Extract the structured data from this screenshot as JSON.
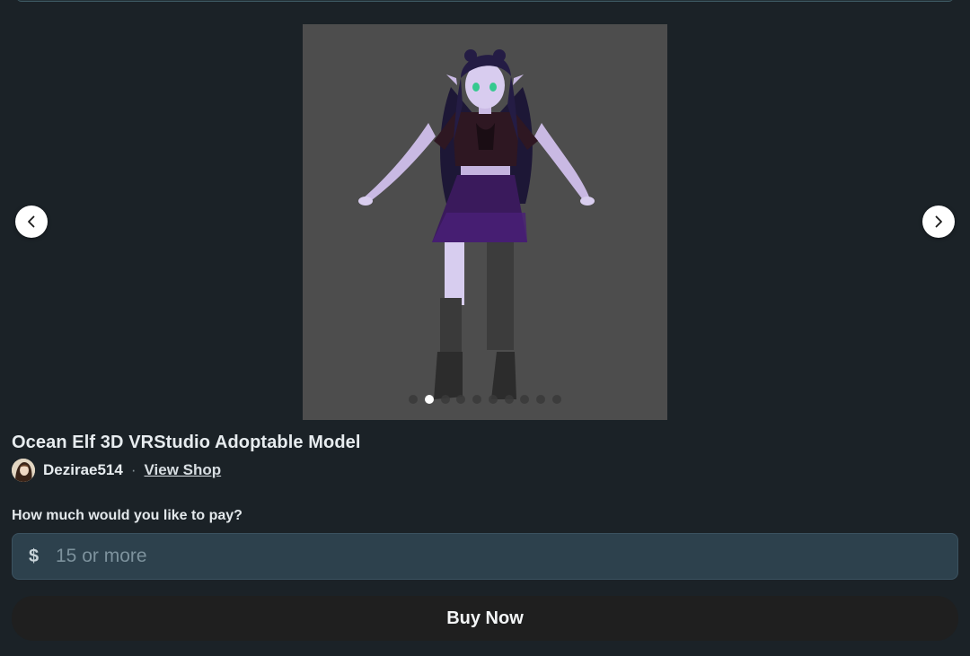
{
  "product": {
    "title": "Ocean Elf 3D VRStudio Adoptable Model"
  },
  "seller": {
    "name": "Dezirae514",
    "separator": "·",
    "view_shop_label": "View Shop"
  },
  "gallery": {
    "slide_count": 10,
    "active_index": 1,
    "prev_icon": "chevron-left-icon",
    "next_icon": "chevron-right-icon"
  },
  "payment": {
    "label": "How much would you like to pay?",
    "currency_symbol": "$",
    "value": "",
    "placeholder": "15 or more"
  },
  "actions": {
    "buy_label": "Buy Now"
  },
  "colors": {
    "background": "#1b2227",
    "slide_bg": "#4d4d4d",
    "field_bg": "#2d414d",
    "button_bg": "#1f1f1f"
  }
}
